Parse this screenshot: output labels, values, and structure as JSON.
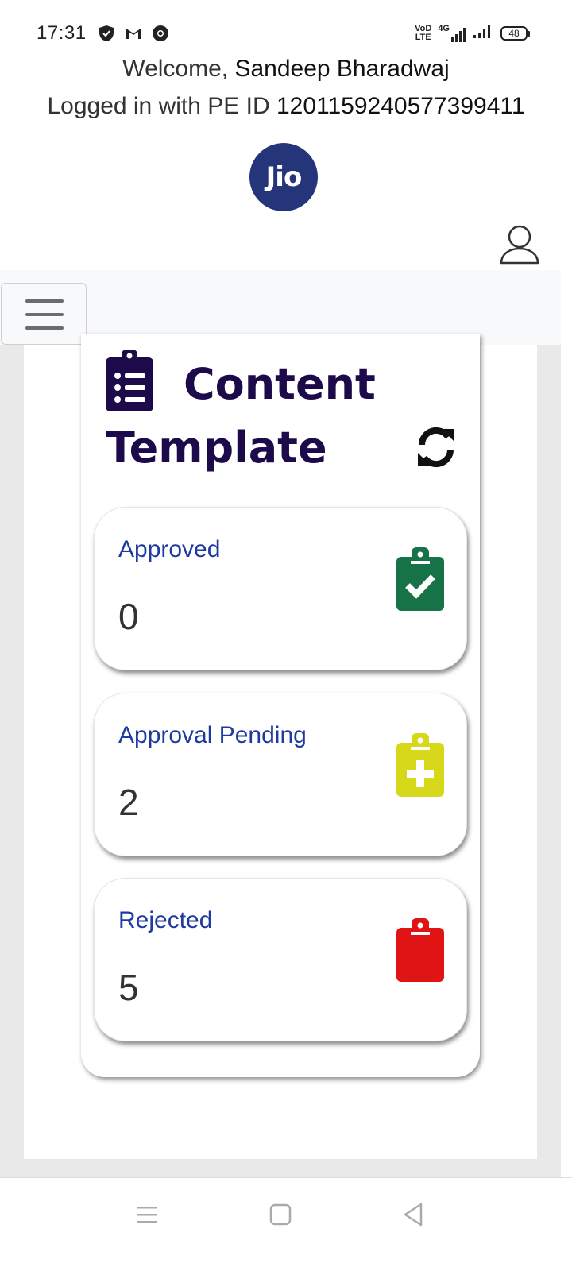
{
  "status_bar": {
    "time": "17:31",
    "left_icons": [
      "shield-icon",
      "gmail-icon",
      "chrome-icon"
    ],
    "network_label_1": "VoD",
    "network_label_2": "LTE",
    "network_type": "4G",
    "battery": "48"
  },
  "header": {
    "welcome_prefix": "Welcome,",
    "user_name": "Sandeep Bharadwaj",
    "pe_prefix": "Logged in with PE ID",
    "pe_id": "1201159240577399411",
    "logo_text": "Jio",
    "brand_color": "#243579"
  },
  "navbar": {
    "menu_icon": "hamburger-icon"
  },
  "content_template": {
    "title_line1": "Content",
    "title_line2": "Template",
    "title_color": "#1d0a4a",
    "cards": [
      {
        "label": "Approved",
        "value": "0",
        "icon": "clipboard-check-icon",
        "icon_color": "#157347"
      },
      {
        "label": "Approval Pending",
        "value": "2",
        "icon": "clipboard-plus-icon",
        "icon_color": "#d8d81a"
      },
      {
        "label": "Rejected",
        "value": "5",
        "icon": "clipboard-icon",
        "icon_color": "#e01414"
      }
    ]
  },
  "bottom_nav": {
    "buttons": [
      "menu-icon",
      "home-icon",
      "back-icon"
    ]
  }
}
